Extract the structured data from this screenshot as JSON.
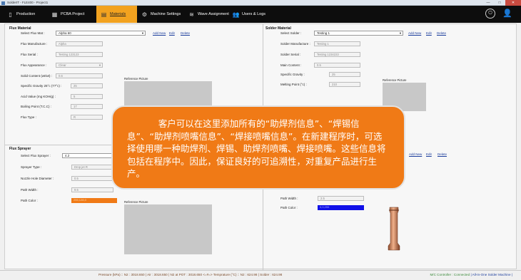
{
  "window": {
    "title": "SolderIT - FLE400 - Project1",
    "minimize": "—",
    "maximize": "□",
    "close": "✕"
  },
  "nav": {
    "tabs": [
      {
        "label": "Production",
        "underline": "P",
        "icon": "document-icon"
      },
      {
        "label": "PCBA Project",
        "icon": "pcb-icon"
      },
      {
        "label": "Materials",
        "underline": "M",
        "icon": "materials-icon",
        "active": true
      },
      {
        "label": "Machine Settings",
        "icon": "gear-icon"
      },
      {
        "label": "Wave Assignment",
        "icon": "wave-icon"
      },
      {
        "label": "Users & Logs",
        "underline": "U",
        "icon": "users-icon"
      }
    ],
    "power_icon": "power-icon",
    "user_icon": "user-icon"
  },
  "flux_material": {
    "title": "Flux Material",
    "select_label": "Select Flux Mat :",
    "select_value": "Alpha 60",
    "add_new": "Add New",
    "edit": "Edit",
    "delete": "Delete",
    "manufacture_label": "Flux Manufacture :",
    "manufacture_value": "Alpha",
    "serial_label": "Flux Serial :",
    "serial_value": "Testing 123123",
    "appearance_label": "Flux Appearance :",
    "appearance_value": "Clear",
    "solid_content_label": "Solid Content (wt/wt) :",
    "solid_content_value": "0.6",
    "specific_gravity_label": "Specific Gravity 25°c (77°c) :",
    "specific_gravity_value": "25",
    "acid_value_label": "Acid Value (mg KOH/g) :",
    "acid_value_value": "5",
    "boiling_point_label": "Boiling Point (T.C.C) :",
    "boiling_point_value": "17",
    "flux_type_label": "Flux Type :",
    "flux_type_value": "R",
    "ref_label": "Reference Picture"
  },
  "solder_material": {
    "title": "Solder Material",
    "select_label": "Select Solder :",
    "select_value": "Testing 1",
    "add_new": "Add New",
    "edit": "Edit",
    "delete": "Delete",
    "manufacture_label": "Solder Manufacture :",
    "manufacture_value": "Testing 1",
    "serial_label": "Solder Serial :",
    "serial_value": "Testing 1234223",
    "main_content_label": "Main Content :",
    "main_content_value": "0.5",
    "specific_gravity_label": "Specific Gravity :",
    "specific_gravity_value": "25",
    "melting_point_label": "Melting Point (°c) :",
    "melting_point_value": "210",
    "ref_label": "Reference Picture"
  },
  "flux_sprayer": {
    "title": "Flux Sprayer",
    "select_label": "Select Flux Sprayer :",
    "select_value": "4.2",
    "sprayer_type_label": "Sprayer Type :",
    "sprayer_type_value": "Drop jet R",
    "nozzle_label": "Nozzle Hole Diameter :",
    "nozzle_value": "0.5",
    "path_width_label": "Path Width :",
    "path_width_value": "9.5",
    "path_color_label": "Path Color :",
    "path_color_value": "255,128,0",
    "path_color_hex": "#f07a16",
    "ref_label": "Reference Picture"
  },
  "solder_nozzle": {
    "add_new": "Add New",
    "edit": "Edit",
    "delete": "Delete",
    "path_width_label": "Path Width :",
    "path_width_value": "2.5",
    "path_color_label": "Path Color :",
    "path_color_value": "0,0,255",
    "path_color_hex": "#1010e8"
  },
  "overlay": {
    "text": "客户可以在这里添加所有的“助焊剂信息”、“焊锡信息”、“助焊剂喷嘴信息”、“焊接喷嘴信息”。在新建程序时，可选择使用哪一种助焊剂、焊锡、助焊剂喷嘴、焊接喷嘴。这些信息将包括在程序中。因此，保证良好的可追溯性，对重复产品进行生产。",
    "bg_color": "#f07a16"
  },
  "status": {
    "main": "Pressure (kPa) :: N2 : 3018.650 | Air : 3018.650 | N2 at POT : 3018.650 <=#=> Temprature (°C) :: N2 : 624.98 | Solder : 624.98",
    "controller": "M/C Controller : Connected",
    "machine": "| All-In-One Solder Machine |"
  }
}
